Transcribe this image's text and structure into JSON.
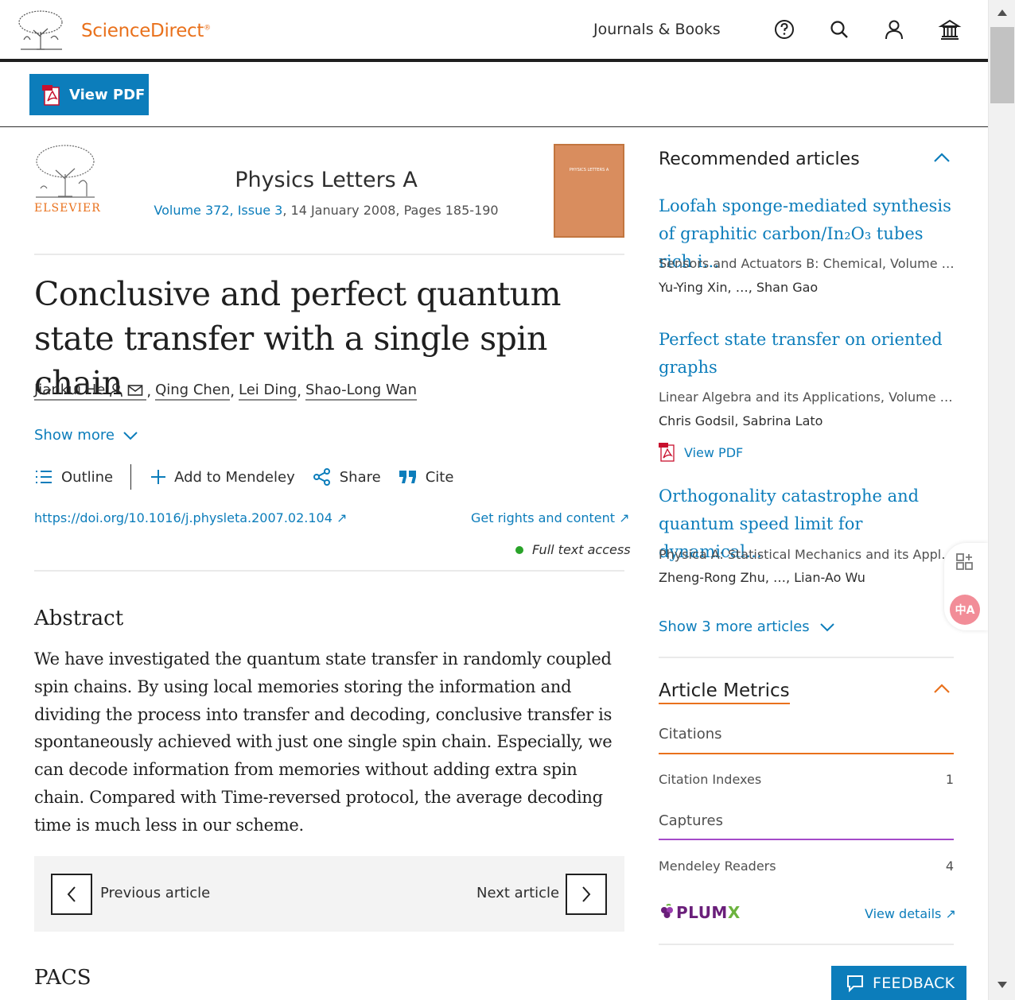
{
  "header": {
    "brand": "ScienceDirect",
    "brand_mark": "®",
    "nav_journals": "Journals & Books",
    "icons": [
      "help-icon",
      "search-icon",
      "user-icon",
      "institution-icon"
    ]
  },
  "pdf_bar": {
    "view_pdf": "View PDF"
  },
  "journal": {
    "publisher": "ELSEVIER",
    "title": "Physics Letters A",
    "volume_issue": "Volume 372, Issue 3",
    "date_pages": ", 14 January 2008, Pages 185-190",
    "cover_text": "PHYSICS LETTERS A"
  },
  "article": {
    "title": "Conclusive and perfect quantum state transfer with a single spin chain",
    "authors": [
      "Jiankui He",
      "Qing Chen",
      "Lei Ding",
      "Shao-Long Wan"
    ],
    "show_more": "Show more",
    "toolbar": {
      "outline": "Outline",
      "mendeley": "Add to Mendeley",
      "share": "Share",
      "cite": "Cite"
    },
    "doi": "https://doi.org/10.1016/j.physleta.2007.02.104",
    "doi_arrow": "↗",
    "rights": "Get rights and content",
    "rights_arrow": "↗",
    "access": "Full text access",
    "abstract_heading": "Abstract",
    "abstract": "We have investigated the quantum state transfer in randomly coupled spin chains. By using local memories storing the information and dividing the process into transfer and decoding, conclusive transfer is spontaneously achieved with just one single spin chain. Especially, we can decode information from memories without adding extra spin chain. Compared with Time-reversed protocol, the average decoding time is much less in our scheme.",
    "previous": "Previous article",
    "next": "Next article",
    "pacs_heading": "PACS"
  },
  "recommended": {
    "heading": "Recommended articles",
    "items": [
      {
        "title": "Loofah sponge-mediated synthesis of graphitic carbon/In₂O₃ tubes rich i…",
        "journal": "Sensors and Actuators B: Chemical, Volume 4…",
        "authors": "Yu-Ying Xin, …, Shan Gao"
      },
      {
        "title": "Perfect state transfer on oriented graphs",
        "journal": "Linear Algebra and its Applications, Volume 6…",
        "authors": "Chris Godsil, Sabrina Lato",
        "pdf": "View PDF"
      },
      {
        "title": "Orthogonality catastrophe and quantum speed limit for dynamical…",
        "journal": "Physica A: Statistical Mechanics and its Appli…",
        "authors": "Zheng-Rong Zhu, …, Lian-Ao Wu"
      }
    ],
    "show_more": "Show 3 more articles"
  },
  "metrics": {
    "heading": "Article Metrics",
    "citations_label": "Citations",
    "citation_indexes_label": "Citation Indexes",
    "citation_indexes_value": "1",
    "captures_label": "Captures",
    "mendeley_label": "Mendeley Readers",
    "mendeley_value": "4",
    "plumx": "PLUM",
    "plumx_x": "X",
    "view_details": "View details ↗",
    "colors": {
      "citations": "#e9711c",
      "captures": "#a54ac9"
    }
  },
  "floating": {
    "translate": "中A",
    "feedback": "FEEDBACK"
  }
}
